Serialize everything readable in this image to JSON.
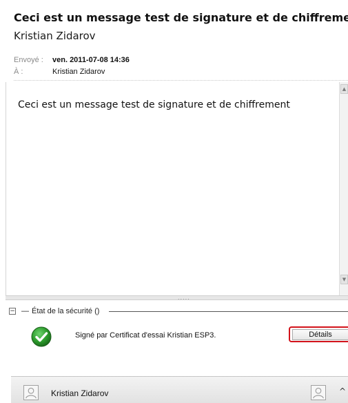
{
  "message": {
    "subject": "Ceci est un message test de signature et de chiffrement",
    "sender": "Kristian Zidarov",
    "sent_label": "Envoyé :",
    "sent_value": "ven. 2011-07-08 14:36",
    "to_label": "À :",
    "to_value": "Kristian Zidarov",
    "body": "Ceci est un message test de signature et de chiffrement"
  },
  "security": {
    "toggle_symbol": "−",
    "dash": "—",
    "title": "État de la sécurité ()",
    "signed_text": "Signé par Certificat d'essai Kristian ESP3.",
    "details_label": "Détails",
    "status_icon": "check-icon",
    "status_color": "#2e9e2e",
    "highlight_color": "#d2121a"
  },
  "scrollbar": {
    "up_symbol": "▲",
    "down_symbol": "▼"
  },
  "splitter": {
    "grip": "....."
  },
  "people_pane": {
    "name": "Kristian Zidarov",
    "collapse_symbol": "^"
  }
}
